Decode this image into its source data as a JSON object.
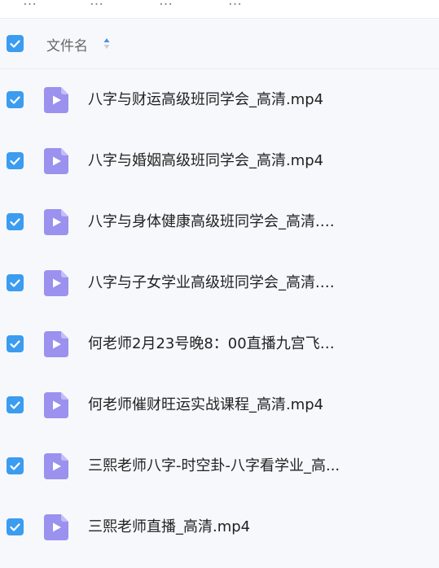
{
  "breadcrumb": [
    "…",
    "…",
    "…",
    "…"
  ],
  "header": {
    "column_label": "文件名"
  },
  "colors": {
    "accent": "#3b9cf0",
    "video_icon": "#9b91ee",
    "sort_active": "#4a90e2",
    "sort_inactive": "#c8ccd6"
  },
  "files": [
    {
      "name": "八字与财运高级班同学会_高清.mp4",
      "icon": "video-file-icon",
      "checked": true
    },
    {
      "name": "八字与婚姻高级班同学会_高清.mp4",
      "icon": "video-file-icon",
      "checked": true
    },
    {
      "name": "八字与身体健康高级班同学会_高清.m...",
      "icon": "video-file-icon",
      "checked": true
    },
    {
      "name": "八字与子女学业高级班同学会_高清.m...",
      "icon": "video-file-icon",
      "checked": true
    },
    {
      "name": "何老师2月23号晚8：00直播九宫飞星...",
      "icon": "video-file-icon",
      "checked": true
    },
    {
      "name": "何老师催财旺运实战课程_高清.mp4",
      "icon": "video-file-icon",
      "checked": true
    },
    {
      "name": "三熙老师八字-时空卦-八字看学业_高...",
      "icon": "video-file-icon",
      "checked": true
    },
    {
      "name": "三熙老师直播_高清.mp4",
      "icon": "video-file-icon",
      "checked": true
    }
  ]
}
